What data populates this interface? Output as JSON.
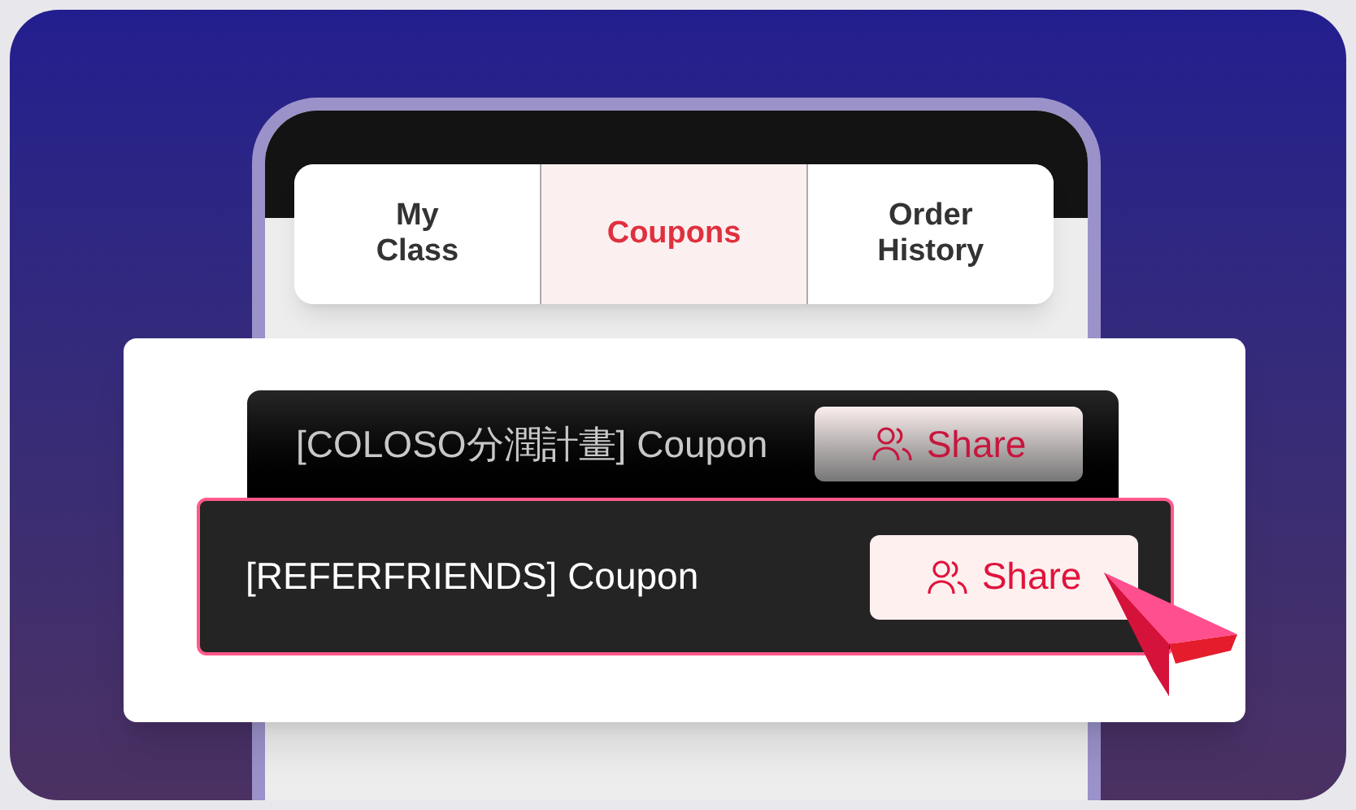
{
  "tabs": [
    {
      "label": "My Class",
      "selected": false
    },
    {
      "label": "Coupons",
      "selected": true
    },
    {
      "label": "Order History",
      "selected": false
    }
  ],
  "coupons": [
    {
      "name": "[COLOSO分潤計畫] Coupon",
      "action": "Share",
      "selected": false
    },
    {
      "name": "[REFERFRIENDS] Coupon",
      "action": "Share",
      "selected": true
    }
  ]
}
